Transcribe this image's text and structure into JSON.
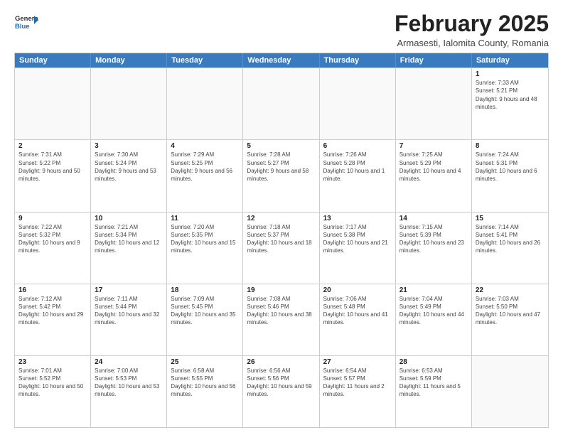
{
  "logo": {
    "general": "General",
    "blue": "Blue"
  },
  "header": {
    "month_year": "February 2025",
    "location": "Armasesti, Ialomita County, Romania"
  },
  "weekdays": [
    "Sunday",
    "Monday",
    "Tuesday",
    "Wednesday",
    "Thursday",
    "Friday",
    "Saturday"
  ],
  "weeks": [
    [
      {
        "day": "",
        "info": ""
      },
      {
        "day": "",
        "info": ""
      },
      {
        "day": "",
        "info": ""
      },
      {
        "day": "",
        "info": ""
      },
      {
        "day": "",
        "info": ""
      },
      {
        "day": "",
        "info": ""
      },
      {
        "day": "1",
        "info": "Sunrise: 7:33 AM\nSunset: 5:21 PM\nDaylight: 9 hours and 48 minutes."
      }
    ],
    [
      {
        "day": "2",
        "info": "Sunrise: 7:31 AM\nSunset: 5:22 PM\nDaylight: 9 hours and 50 minutes."
      },
      {
        "day": "3",
        "info": "Sunrise: 7:30 AM\nSunset: 5:24 PM\nDaylight: 9 hours and 53 minutes."
      },
      {
        "day": "4",
        "info": "Sunrise: 7:29 AM\nSunset: 5:25 PM\nDaylight: 9 hours and 56 minutes."
      },
      {
        "day": "5",
        "info": "Sunrise: 7:28 AM\nSunset: 5:27 PM\nDaylight: 9 hours and 58 minutes."
      },
      {
        "day": "6",
        "info": "Sunrise: 7:26 AM\nSunset: 5:28 PM\nDaylight: 10 hours and 1 minute."
      },
      {
        "day": "7",
        "info": "Sunrise: 7:25 AM\nSunset: 5:29 PM\nDaylight: 10 hours and 4 minutes."
      },
      {
        "day": "8",
        "info": "Sunrise: 7:24 AM\nSunset: 5:31 PM\nDaylight: 10 hours and 6 minutes."
      }
    ],
    [
      {
        "day": "9",
        "info": "Sunrise: 7:22 AM\nSunset: 5:32 PM\nDaylight: 10 hours and 9 minutes."
      },
      {
        "day": "10",
        "info": "Sunrise: 7:21 AM\nSunset: 5:34 PM\nDaylight: 10 hours and 12 minutes."
      },
      {
        "day": "11",
        "info": "Sunrise: 7:20 AM\nSunset: 5:35 PM\nDaylight: 10 hours and 15 minutes."
      },
      {
        "day": "12",
        "info": "Sunrise: 7:18 AM\nSunset: 5:37 PM\nDaylight: 10 hours and 18 minutes."
      },
      {
        "day": "13",
        "info": "Sunrise: 7:17 AM\nSunset: 5:38 PM\nDaylight: 10 hours and 21 minutes."
      },
      {
        "day": "14",
        "info": "Sunrise: 7:15 AM\nSunset: 5:39 PM\nDaylight: 10 hours and 23 minutes."
      },
      {
        "day": "15",
        "info": "Sunrise: 7:14 AM\nSunset: 5:41 PM\nDaylight: 10 hours and 26 minutes."
      }
    ],
    [
      {
        "day": "16",
        "info": "Sunrise: 7:12 AM\nSunset: 5:42 PM\nDaylight: 10 hours and 29 minutes."
      },
      {
        "day": "17",
        "info": "Sunrise: 7:11 AM\nSunset: 5:44 PM\nDaylight: 10 hours and 32 minutes."
      },
      {
        "day": "18",
        "info": "Sunrise: 7:09 AM\nSunset: 5:45 PM\nDaylight: 10 hours and 35 minutes."
      },
      {
        "day": "19",
        "info": "Sunrise: 7:08 AM\nSunset: 5:46 PM\nDaylight: 10 hours and 38 minutes."
      },
      {
        "day": "20",
        "info": "Sunrise: 7:06 AM\nSunset: 5:48 PM\nDaylight: 10 hours and 41 minutes."
      },
      {
        "day": "21",
        "info": "Sunrise: 7:04 AM\nSunset: 5:49 PM\nDaylight: 10 hours and 44 minutes."
      },
      {
        "day": "22",
        "info": "Sunrise: 7:03 AM\nSunset: 5:50 PM\nDaylight: 10 hours and 47 minutes."
      }
    ],
    [
      {
        "day": "23",
        "info": "Sunrise: 7:01 AM\nSunset: 5:52 PM\nDaylight: 10 hours and 50 minutes."
      },
      {
        "day": "24",
        "info": "Sunrise: 7:00 AM\nSunset: 5:53 PM\nDaylight: 10 hours and 53 minutes."
      },
      {
        "day": "25",
        "info": "Sunrise: 6:58 AM\nSunset: 5:55 PM\nDaylight: 10 hours and 56 minutes."
      },
      {
        "day": "26",
        "info": "Sunrise: 6:56 AM\nSunset: 5:56 PM\nDaylight: 10 hours and 59 minutes."
      },
      {
        "day": "27",
        "info": "Sunrise: 6:54 AM\nSunset: 5:57 PM\nDaylight: 11 hours and 2 minutes."
      },
      {
        "day": "28",
        "info": "Sunrise: 6:53 AM\nSunset: 5:59 PM\nDaylight: 11 hours and 5 minutes."
      },
      {
        "day": "",
        "info": ""
      }
    ]
  ]
}
